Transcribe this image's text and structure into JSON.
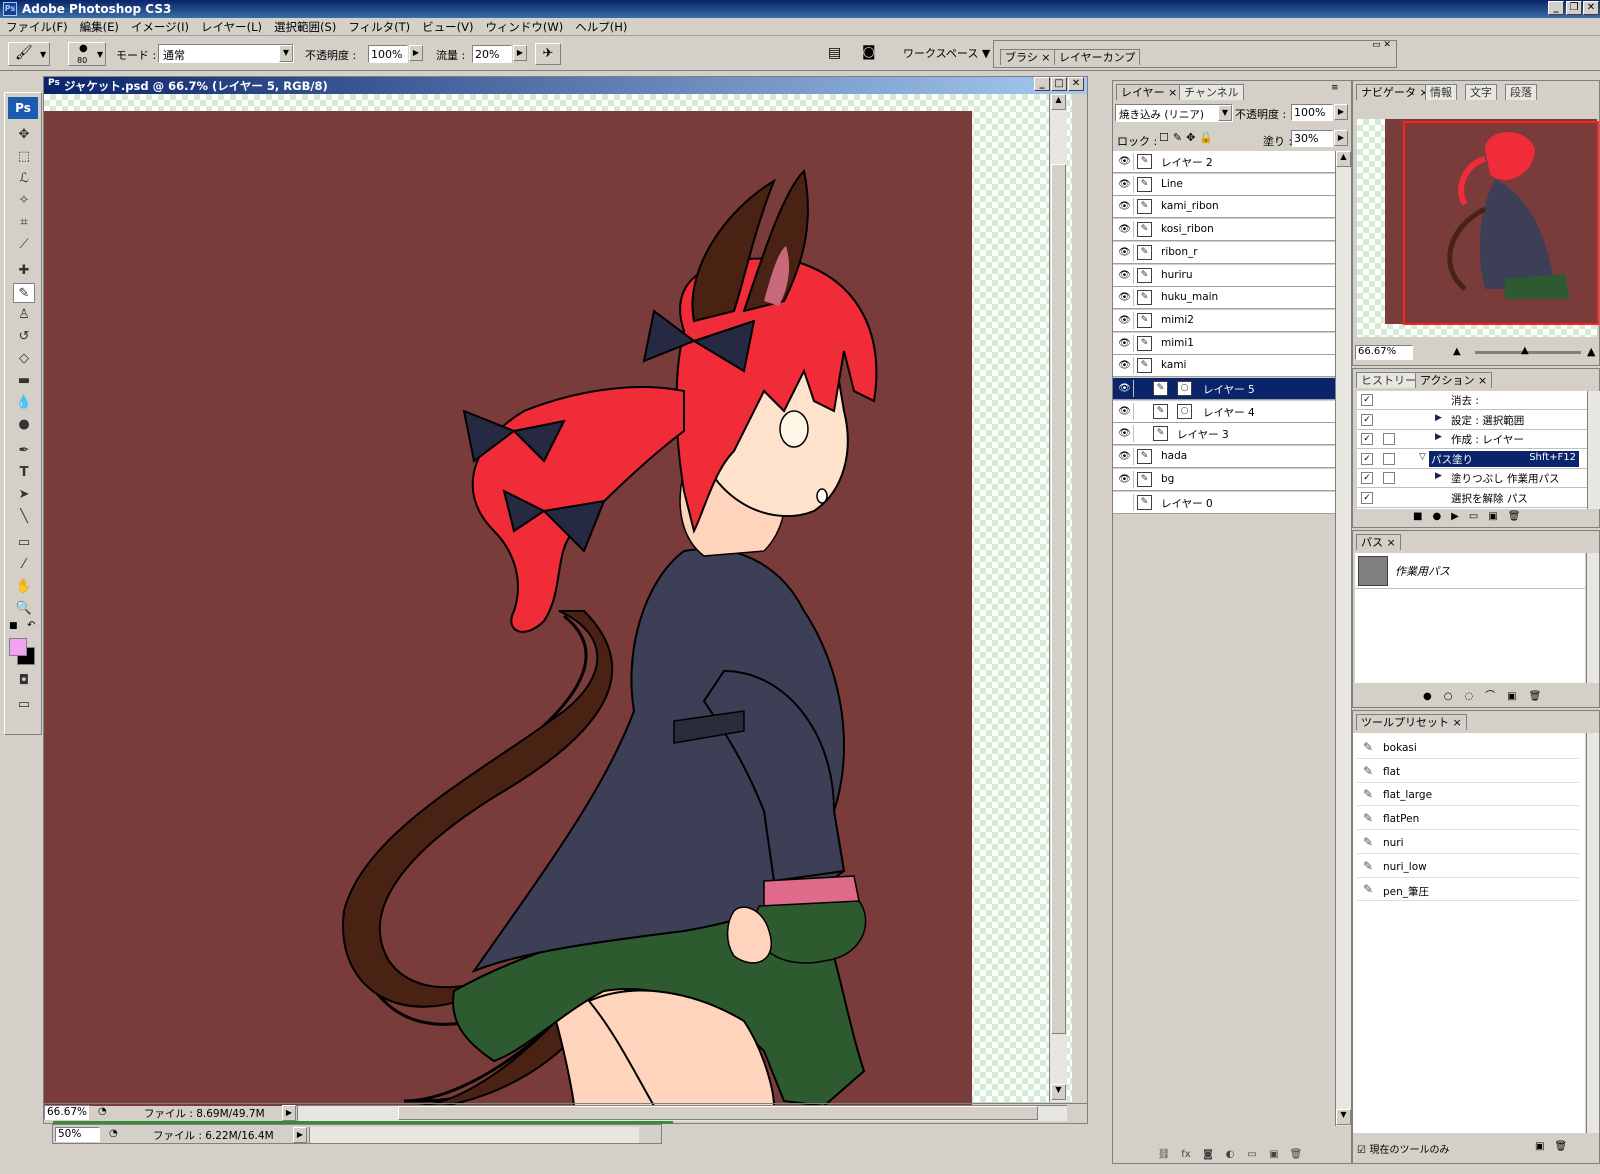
{
  "app": {
    "title": "Adobe Photoshop CS3",
    "icon_text": "Ps"
  },
  "menu": [
    "ファイル(F)",
    "編集(E)",
    "イメージ(I)",
    "レイヤー(L)",
    "選択範囲(S)",
    "フィルタ(T)",
    "ビュー(V)",
    "ウィンドウ(W)",
    "ヘルプ(H)"
  ],
  "options": {
    "brush_size": "80",
    "mode_label": "モード :",
    "mode_value": "通常",
    "opacity_label": "不透明度 :",
    "opacity_value": "100%",
    "flow_label": "流量 :",
    "flow_value": "20%",
    "workspace_label": "ワークスペース ▼",
    "dock_tabs": [
      "ブラシ",
      "レイヤーカンプ"
    ]
  },
  "document": {
    "title": "ジャケット.psd @ 66.7% (レイヤー 5, RGB/8)",
    "zoom": "66.67%",
    "file_info": "ファイル : 8.69M/49.7M",
    "canvas_bg": "#7a3b3b"
  },
  "document2": {
    "zoom": "50%",
    "file_info": "ファイル : 6.22M/16.4M"
  },
  "layers_panel": {
    "tabs": [
      "レイヤー",
      "チャンネル"
    ],
    "blend_mode": "焼き込み (リニア)",
    "opacity_label": "不透明度 :",
    "opacity_value": "100%",
    "lock_label": "ロック :",
    "fill_label": "塗り :",
    "fill_value": "30%",
    "layers": [
      {
        "name": "レイヤー 2",
        "visible": true
      },
      {
        "name": "Line",
        "visible": true
      },
      {
        "name": "kami_ribon",
        "visible": true
      },
      {
        "name": "kosi_ribon",
        "visible": true
      },
      {
        "name": "ribon_r",
        "visible": true
      },
      {
        "name": "huriru",
        "visible": true
      },
      {
        "name": "huku_main",
        "visible": true
      },
      {
        "name": "mimi2",
        "visible": true
      },
      {
        "name": "mimi1",
        "visible": true
      },
      {
        "name": "kami",
        "visible": true
      },
      {
        "name": "レイヤー 5",
        "visible": true,
        "selected": true
      },
      {
        "name": "レイヤー 4",
        "visible": true
      },
      {
        "name": "レイヤー 3",
        "visible": true
      },
      {
        "name": "hada",
        "visible": true
      },
      {
        "name": "bg",
        "visible": true
      },
      {
        "name": "レイヤー 0",
        "visible": false
      }
    ]
  },
  "navigator": {
    "tabs": [
      "ナビゲータ",
      "情報",
      "文字",
      "段落"
    ],
    "zoom": "66.67%"
  },
  "actions_panel": {
    "tabs": [
      "ヒストリー",
      "アクション"
    ],
    "items": [
      {
        "label": "消去 :"
      },
      {
        "label": "設定 : 選択範囲"
      },
      {
        "label": "作成 : レイヤー"
      },
      {
        "label": "パス塗り",
        "shortcut": "Shft+F12",
        "selected": true
      },
      {
        "label": "塗りつぶし 作業用パス"
      },
      {
        "label": "選択を解除 パス"
      }
    ]
  },
  "paths_panel": {
    "tab": "パス",
    "path_name": "作業用パス"
  },
  "presets_panel": {
    "tab": "ツールプリセット",
    "items": [
      "bokasi",
      "flat",
      "flat_large",
      "flatPen",
      "nuri",
      "nuri_low",
      "pen_筆圧"
    ],
    "current_only_label": "現在のツールのみ"
  },
  "colors": {
    "foreground": "#f4a0f4",
    "background": "#000000",
    "selection": "#0a246a"
  }
}
